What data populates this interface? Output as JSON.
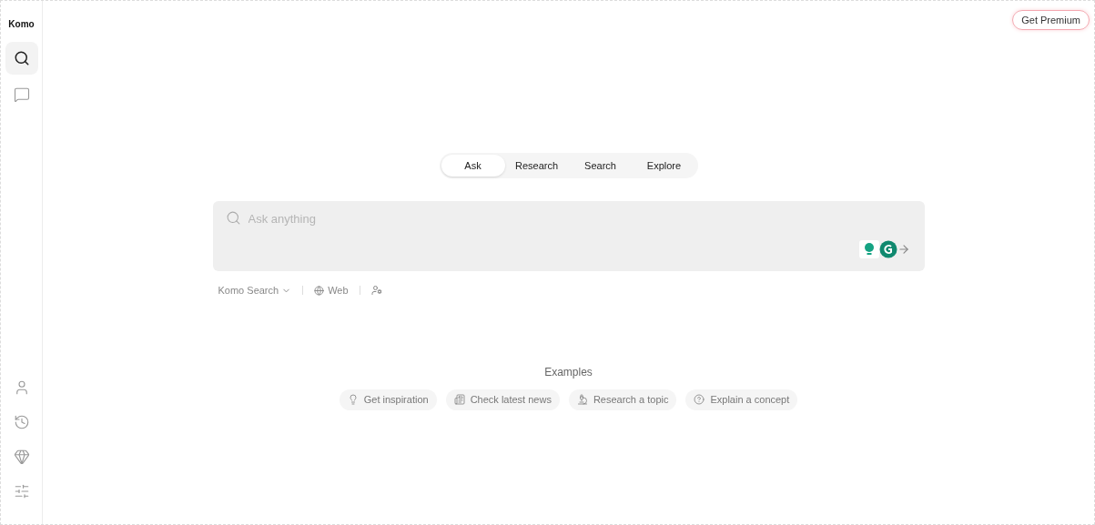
{
  "brand": "Komo",
  "sidebar": {
    "top_items": [
      {
        "kind": "search",
        "selected": true
      },
      {
        "kind": "chat",
        "selected": false
      }
    ],
    "bottom_items": [
      {
        "kind": "profile",
        "selected": false
      },
      {
        "kind": "history",
        "selected": false
      },
      {
        "kind": "premium",
        "selected": false
      },
      {
        "kind": "settings",
        "selected": false
      }
    ]
  },
  "premium_button": "Get Premium",
  "tabs": [
    {
      "label": "Ask",
      "selected": true
    },
    {
      "label": "Research",
      "selected": false
    },
    {
      "label": "Search",
      "selected": false
    },
    {
      "label": "Explore",
      "selected": false
    }
  ],
  "search": {
    "placeholder": "Ask anything"
  },
  "options": {
    "model": "Komo Search",
    "source": "Web"
  },
  "examples": {
    "title": "Examples",
    "items": [
      {
        "kind": "idea",
        "label": "Get inspiration"
      },
      {
        "kind": "news",
        "label": "Check latest news"
      },
      {
        "kind": "research",
        "label": "Research a topic"
      },
      {
        "kind": "explain",
        "label": "Explain a concept"
      }
    ]
  }
}
